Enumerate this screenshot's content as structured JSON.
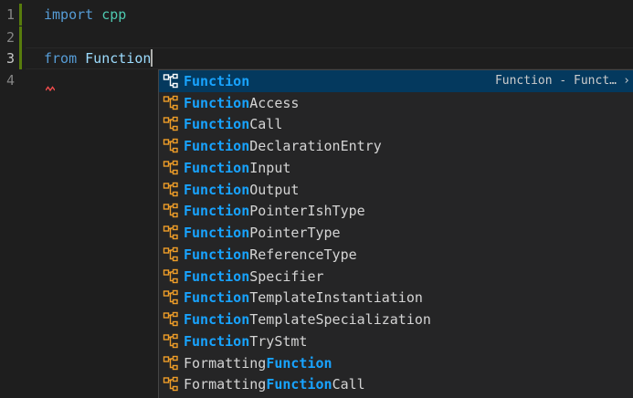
{
  "colors": {
    "background": "#1e1e1e",
    "git_added": "#587c0c",
    "keyword": "#569cd6",
    "module": "#4ec9b0",
    "match_highlight": "#18a3ff",
    "selected_row": "#04395e",
    "icon": "#ee9d28"
  },
  "editor": {
    "lines": [
      {
        "number": "1",
        "keyword": "import",
        "name": "cpp"
      },
      {
        "number": "2"
      },
      {
        "number": "3",
        "keyword": "from",
        "name": "Function"
      },
      {
        "number": "4"
      }
    ]
  },
  "suggest": {
    "query": "Function",
    "items": [
      {
        "pre": "",
        "match": "Function",
        "post": "",
        "detail": "Function - Funct…",
        "chevron": "›",
        "icon": "class-icon"
      },
      {
        "pre": "",
        "match": "Function",
        "post": "Access",
        "icon": "class-icon"
      },
      {
        "pre": "",
        "match": "Function",
        "post": "Call",
        "icon": "class-icon"
      },
      {
        "pre": "",
        "match": "Function",
        "post": "DeclarationEntry",
        "icon": "class-icon"
      },
      {
        "pre": "",
        "match": "Function",
        "post": "Input",
        "icon": "class-icon"
      },
      {
        "pre": "",
        "match": "Function",
        "post": "Output",
        "icon": "class-icon"
      },
      {
        "pre": "",
        "match": "Function",
        "post": "PointerIshType",
        "icon": "class-icon"
      },
      {
        "pre": "",
        "match": "Function",
        "post": "PointerType",
        "icon": "class-icon"
      },
      {
        "pre": "",
        "match": "Function",
        "post": "ReferenceType",
        "icon": "class-icon"
      },
      {
        "pre": "",
        "match": "Function",
        "post": "Specifier",
        "icon": "class-icon"
      },
      {
        "pre": "",
        "match": "Function",
        "post": "TemplateInstantiation",
        "icon": "class-icon"
      },
      {
        "pre": "",
        "match": "Function",
        "post": "TemplateSpecialization",
        "icon": "class-icon"
      },
      {
        "pre": "",
        "match": "Function",
        "post": "TryStmt",
        "icon": "class-icon"
      },
      {
        "pre": "Formatting",
        "match": "Function",
        "post": "",
        "icon": "class-icon"
      },
      {
        "pre": "Formatting",
        "match": "Function",
        "post": "Call",
        "icon": "class-icon"
      }
    ]
  }
}
